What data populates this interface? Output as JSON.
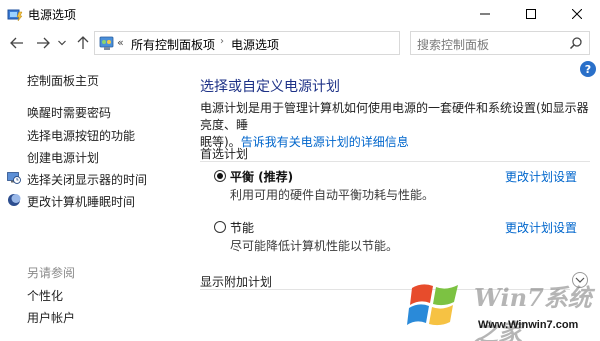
{
  "window": {
    "title": "电源选项",
    "icon": "power-options-icon",
    "controls": [
      "minimize-icon",
      "maximize-icon",
      "close-icon"
    ]
  },
  "nav": {
    "back_icon": "arrow-left-icon",
    "forward_icon": "arrow-right-icon",
    "recent_icon": "chevron-down-icon",
    "up_icon": "arrow-up-icon",
    "address": {
      "icon": "control-panel-icon",
      "overflow": "«",
      "crumbs": [
        "所有控制面板项",
        "电源选项"
      ]
    },
    "refresh_icon": "refresh-icon",
    "search": {
      "placeholder": "搜索控制面板",
      "icon": "search-icon"
    }
  },
  "help_label": "?",
  "sidebar": {
    "home": "控制面板主页",
    "links": [
      {
        "label": "唤醒时需要密码",
        "icon": null
      },
      {
        "label": "选择电源按钮的功能",
        "icon": null
      },
      {
        "label": "创建电源计划",
        "icon": null
      },
      {
        "label": "选择关闭显示器的时间",
        "icon": "monitor-clock-icon"
      },
      {
        "label": "更改计算机睡眠时间",
        "icon": "moon-icon"
      }
    ],
    "see_also": {
      "heading": "另请参阅",
      "links": [
        "个性化",
        "用户帐户"
      ]
    }
  },
  "main": {
    "title": "选择或自定义电源计划",
    "description_line1": "电源计划是用于管理计算机如何使用电源的一套硬件和系统设置(如显示器亮度、睡",
    "description_line2_prefix": "眠等)。",
    "description_link": "告诉我有关电源计划的详细信息",
    "preferred_heading": "首选计划",
    "plans": [
      {
        "name": "平衡 (推荐)",
        "desc": "利用可用的硬件自动平衡功耗与性能。",
        "link": "更改计划设置",
        "selected": true
      },
      {
        "name": "节能",
        "desc": "尽可能降低计算机性能以节能。",
        "link": "更改计划设置",
        "selected": false
      }
    ],
    "additional_heading": "显示附加计划",
    "expander_icon": "chevron-down-circle-icon"
  },
  "watermark": {
    "brand": "Win7系统之家",
    "url": "Www.Winwin7.com"
  }
}
